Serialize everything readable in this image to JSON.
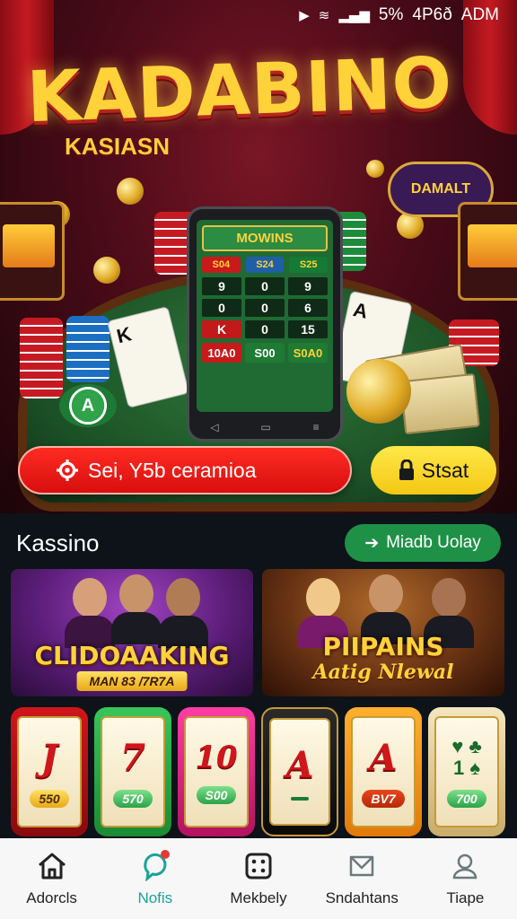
{
  "status_bar": {
    "battery": "5%",
    "network": "4P6ð",
    "time": "ADM"
  },
  "hero": {
    "logo": "KADABINO",
    "logo_sub": "KASIASN",
    "sign_text": "DAMALT",
    "phone": {
      "title": "MOWINS",
      "chip_values": [
        "S04",
        "S24",
        "S25"
      ],
      "grid": [
        "9",
        "0",
        "9",
        "0",
        "0",
        "6",
        "K",
        "0",
        "15"
      ],
      "bottom": [
        "10A0",
        "S00",
        "S0A0"
      ]
    },
    "cta_primary": "Sei, Y5b ceramioa",
    "cta_secondary": "Stsat"
  },
  "section": {
    "title": "Kassino",
    "view_button": "Miadb Uolay"
  },
  "banners": [
    {
      "title": "CLIDOAAKING",
      "subtitle": "MAN 83 /7R7A"
    },
    {
      "title": "PIIPAINS",
      "subtitle": "Aatig Nlewal"
    }
  ],
  "slots": [
    {
      "symbol": "J",
      "value": "550",
      "color": "#c0161b"
    },
    {
      "symbol": "7",
      "value": "570",
      "color": "#2db34a"
    },
    {
      "symbol": "10",
      "value": "S00",
      "color": "#e0238a"
    },
    {
      "symbol": "A",
      "value": "",
      "color": "#1a1a1a"
    },
    {
      "symbol": "A",
      "value": "BV7",
      "color": "#f29a14"
    },
    {
      "symbol": "",
      "value": "700",
      "color": "#e9d9b0"
    }
  ],
  "tabbar": [
    {
      "label": "Adorcls",
      "icon": "home-icon"
    },
    {
      "label": "Nofis",
      "icon": "notification-icon"
    },
    {
      "label": "Mekbely",
      "icon": "dice-icon"
    },
    {
      "label": "Sndahtans",
      "icon": "ticket-icon"
    },
    {
      "label": "Tiape",
      "icon": "profile-icon"
    }
  ],
  "colors": {
    "accent_green": "#1f9147",
    "cta_red": "#e8140f",
    "cta_yellow": "#f8d51f",
    "active_tab": "#1aa39a"
  }
}
